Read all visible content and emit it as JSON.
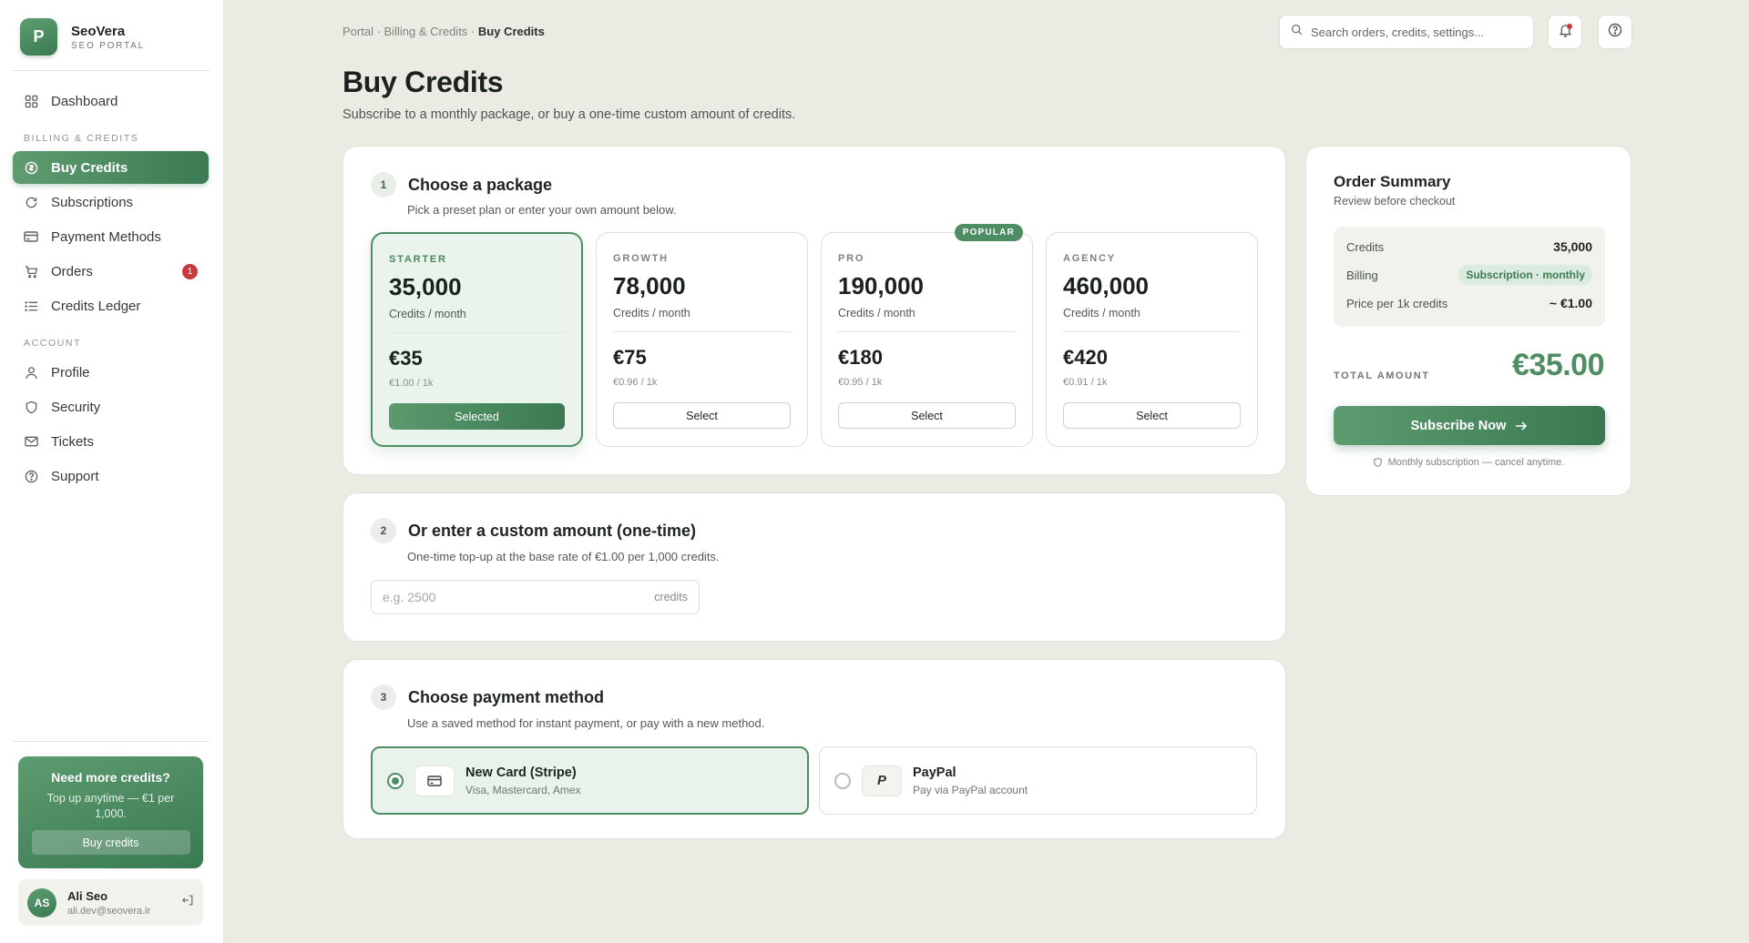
{
  "brand": {
    "logo_letter": "P",
    "name": "SeoVera",
    "subtitle": "SEO PORTAL"
  },
  "sidebar": {
    "dashboard": {
      "label": "Dashboard",
      "icon": "grid-icon"
    },
    "billing_section": "BILLING & CREDITS",
    "billing_items": [
      {
        "label": "Buy Credits",
        "icon": "coin-icon",
        "active": true
      },
      {
        "label": "Subscriptions",
        "icon": "refresh-icon"
      },
      {
        "label": "Payment Methods",
        "icon": "card-icon"
      },
      {
        "label": "Orders",
        "icon": "cart-icon",
        "badge": "1"
      },
      {
        "label": "Credits Ledger",
        "icon": "list-icon"
      }
    ],
    "account_section": "ACCOUNT",
    "account_items": [
      {
        "label": "Profile",
        "icon": "user-icon"
      },
      {
        "label": "Security",
        "icon": "shield-icon"
      },
      {
        "label": "Tickets",
        "icon": "mail-icon"
      },
      {
        "label": "Support",
        "icon": "help-icon"
      }
    ],
    "promo": {
      "title": "Need more credits?",
      "text": "Top up anytime — €1 per 1,000.",
      "button": "Buy credits"
    },
    "user": {
      "initials": "AS",
      "name": "Ali Seo",
      "email": "ali.dev@seovera.ir"
    }
  },
  "topbar": {
    "breadcrumb": [
      "Portal",
      "Billing & Credits",
      "Buy Credits"
    ],
    "search_placeholder": "Search orders, credits, settings..."
  },
  "page": {
    "title": "Buy Credits",
    "subtitle": "Subscribe to a monthly package, or buy a one-time custom amount of credits."
  },
  "step1": {
    "num": "1",
    "title": "Choose a package",
    "subtitle": "Pick a preset plan or enter your own amount below.",
    "packages": [
      {
        "name": "STARTER",
        "credits": "35,000",
        "unit": "Credits / month",
        "price": "€35",
        "per": "€1.00 / 1k",
        "button": "Selected",
        "selected": true
      },
      {
        "name": "GROWTH",
        "credits": "78,000",
        "unit": "Credits / month",
        "price": "€75",
        "per": "€0.96 / 1k",
        "button": "Select"
      },
      {
        "name": "PRO",
        "credits": "190,000",
        "unit": "Credits / month",
        "price": "€180",
        "per": "€0.95 / 1k",
        "button": "Select",
        "tag": "POPULAR"
      },
      {
        "name": "AGENCY",
        "credits": "460,000",
        "unit": "Credits / month",
        "price": "€420",
        "per": "€0.91 / 1k",
        "button": "Select"
      }
    ]
  },
  "step2": {
    "num": "2",
    "title": "Or enter a custom amount (one-time)",
    "subtitle": "One-time top-up at the base rate of €1.00 per 1,000 credits.",
    "placeholder": "e.g. 2500",
    "value": "",
    "suffix": "credits"
  },
  "step3": {
    "num": "3",
    "title": "Choose payment method",
    "subtitle": "Use a saved method for instant payment, or pay with a new method.",
    "methods": [
      {
        "name": "New Card (Stripe)",
        "desc": "Visa, Mastercard, Amex",
        "icon": "card-icon",
        "selected": true
      },
      {
        "name": "PayPal",
        "desc": "Pay via PayPal account",
        "icon": "paypal-icon",
        "selected": false
      }
    ]
  },
  "summary": {
    "title": "Order Summary",
    "subtitle": "Review before checkout",
    "rows": [
      {
        "label": "Credits",
        "value": "35,000"
      },
      {
        "label": "Billing",
        "value": "Subscription · monthly"
      },
      {
        "label": "Price per 1k credits",
        "value": "~ €1.00"
      }
    ],
    "total_label": "TOTAL AMOUNT",
    "total_value": "€35.00",
    "cta": "Subscribe Now",
    "note": "Monthly subscription — cancel anytime."
  },
  "colors": {
    "accent": "#4e8d63",
    "accent_dark": "#3a7a52",
    "background": "#ebebe4",
    "badge": "#c8383d"
  }
}
